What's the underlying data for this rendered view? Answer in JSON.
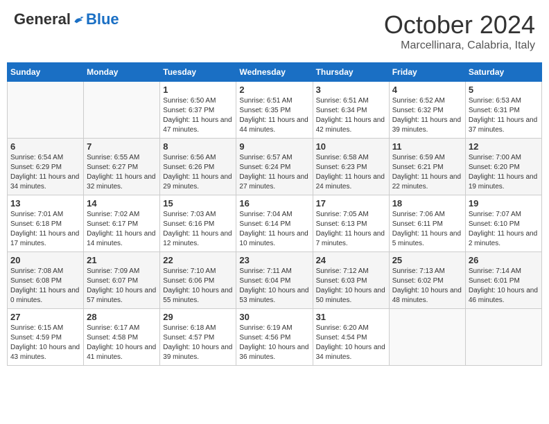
{
  "header": {
    "logo_general": "General",
    "logo_blue": "Blue",
    "month_title": "October 2024",
    "location": "Marcellinara, Calabria, Italy"
  },
  "calendar": {
    "days_of_week": [
      "Sunday",
      "Monday",
      "Tuesday",
      "Wednesday",
      "Thursday",
      "Friday",
      "Saturday"
    ],
    "weeks": [
      [
        {
          "day": null,
          "info": null
        },
        {
          "day": null,
          "info": null
        },
        {
          "day": "1",
          "info": "Sunrise: 6:50 AM\nSunset: 6:37 PM\nDaylight: 11 hours and 47 minutes."
        },
        {
          "day": "2",
          "info": "Sunrise: 6:51 AM\nSunset: 6:35 PM\nDaylight: 11 hours and 44 minutes."
        },
        {
          "day": "3",
          "info": "Sunrise: 6:51 AM\nSunset: 6:34 PM\nDaylight: 11 hours and 42 minutes."
        },
        {
          "day": "4",
          "info": "Sunrise: 6:52 AM\nSunset: 6:32 PM\nDaylight: 11 hours and 39 minutes."
        },
        {
          "day": "5",
          "info": "Sunrise: 6:53 AM\nSunset: 6:31 PM\nDaylight: 11 hours and 37 minutes."
        }
      ],
      [
        {
          "day": "6",
          "info": "Sunrise: 6:54 AM\nSunset: 6:29 PM\nDaylight: 11 hours and 34 minutes."
        },
        {
          "day": "7",
          "info": "Sunrise: 6:55 AM\nSunset: 6:27 PM\nDaylight: 11 hours and 32 minutes."
        },
        {
          "day": "8",
          "info": "Sunrise: 6:56 AM\nSunset: 6:26 PM\nDaylight: 11 hours and 29 minutes."
        },
        {
          "day": "9",
          "info": "Sunrise: 6:57 AM\nSunset: 6:24 PM\nDaylight: 11 hours and 27 minutes."
        },
        {
          "day": "10",
          "info": "Sunrise: 6:58 AM\nSunset: 6:23 PM\nDaylight: 11 hours and 24 minutes."
        },
        {
          "day": "11",
          "info": "Sunrise: 6:59 AM\nSunset: 6:21 PM\nDaylight: 11 hours and 22 minutes."
        },
        {
          "day": "12",
          "info": "Sunrise: 7:00 AM\nSunset: 6:20 PM\nDaylight: 11 hours and 19 minutes."
        }
      ],
      [
        {
          "day": "13",
          "info": "Sunrise: 7:01 AM\nSunset: 6:18 PM\nDaylight: 11 hours and 17 minutes."
        },
        {
          "day": "14",
          "info": "Sunrise: 7:02 AM\nSunset: 6:17 PM\nDaylight: 11 hours and 14 minutes."
        },
        {
          "day": "15",
          "info": "Sunrise: 7:03 AM\nSunset: 6:16 PM\nDaylight: 11 hours and 12 minutes."
        },
        {
          "day": "16",
          "info": "Sunrise: 7:04 AM\nSunset: 6:14 PM\nDaylight: 11 hours and 10 minutes."
        },
        {
          "day": "17",
          "info": "Sunrise: 7:05 AM\nSunset: 6:13 PM\nDaylight: 11 hours and 7 minutes."
        },
        {
          "day": "18",
          "info": "Sunrise: 7:06 AM\nSunset: 6:11 PM\nDaylight: 11 hours and 5 minutes."
        },
        {
          "day": "19",
          "info": "Sunrise: 7:07 AM\nSunset: 6:10 PM\nDaylight: 11 hours and 2 minutes."
        }
      ],
      [
        {
          "day": "20",
          "info": "Sunrise: 7:08 AM\nSunset: 6:08 PM\nDaylight: 11 hours and 0 minutes."
        },
        {
          "day": "21",
          "info": "Sunrise: 7:09 AM\nSunset: 6:07 PM\nDaylight: 10 hours and 57 minutes."
        },
        {
          "day": "22",
          "info": "Sunrise: 7:10 AM\nSunset: 6:06 PM\nDaylight: 10 hours and 55 minutes."
        },
        {
          "day": "23",
          "info": "Sunrise: 7:11 AM\nSunset: 6:04 PM\nDaylight: 10 hours and 53 minutes."
        },
        {
          "day": "24",
          "info": "Sunrise: 7:12 AM\nSunset: 6:03 PM\nDaylight: 10 hours and 50 minutes."
        },
        {
          "day": "25",
          "info": "Sunrise: 7:13 AM\nSunset: 6:02 PM\nDaylight: 10 hours and 48 minutes."
        },
        {
          "day": "26",
          "info": "Sunrise: 7:14 AM\nSunset: 6:01 PM\nDaylight: 10 hours and 46 minutes."
        }
      ],
      [
        {
          "day": "27",
          "info": "Sunrise: 6:15 AM\nSunset: 4:59 PM\nDaylight: 10 hours and 43 minutes."
        },
        {
          "day": "28",
          "info": "Sunrise: 6:17 AM\nSunset: 4:58 PM\nDaylight: 10 hours and 41 minutes."
        },
        {
          "day": "29",
          "info": "Sunrise: 6:18 AM\nSunset: 4:57 PM\nDaylight: 10 hours and 39 minutes."
        },
        {
          "day": "30",
          "info": "Sunrise: 6:19 AM\nSunset: 4:56 PM\nDaylight: 10 hours and 36 minutes."
        },
        {
          "day": "31",
          "info": "Sunrise: 6:20 AM\nSunset: 4:54 PM\nDaylight: 10 hours and 34 minutes."
        },
        {
          "day": null,
          "info": null
        },
        {
          "day": null,
          "info": null
        }
      ]
    ]
  }
}
